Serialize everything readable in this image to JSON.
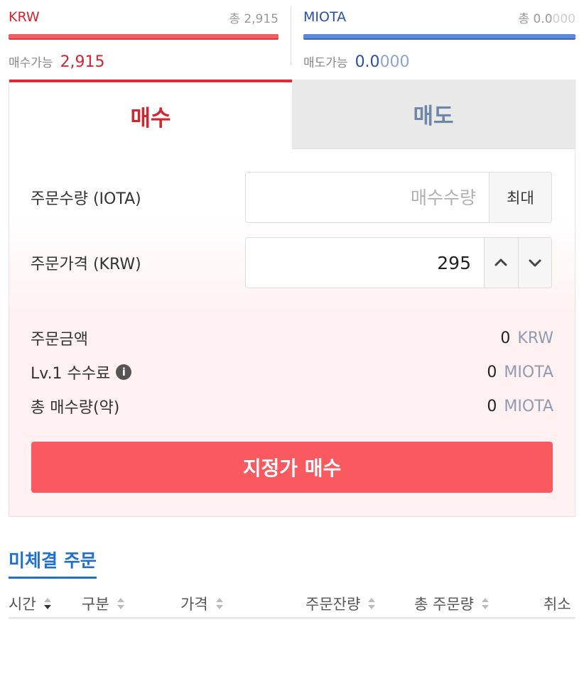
{
  "balances": {
    "krw": {
      "currency": "KRW",
      "total_label": "총",
      "total_value": "2,915",
      "total_dim": "",
      "available_label": "매수가능",
      "available_value": "2,915",
      "color": "#d4242f"
    },
    "miota": {
      "currency": "MIOTA",
      "total_label": "총",
      "total_value": "0.0",
      "total_dim": "000",
      "available_label": "매도가능",
      "available_value": "0.0",
      "available_dim": "000",
      "color": "#2a4fa8"
    }
  },
  "tabs": [
    {
      "label": "매수",
      "active": true
    },
    {
      "label": "매도",
      "active": false
    }
  ],
  "form": {
    "quantity": {
      "label": "주문수량 (IOTA)",
      "placeholder": "매수수량",
      "value": "",
      "max_label": "최대"
    },
    "price": {
      "label": "주문가격 (KRW)",
      "value": "295",
      "up_icon": "chevron-up-icon",
      "down_icon": "chevron-down-icon"
    }
  },
  "summary": {
    "amount": {
      "label": "주문금액",
      "value": "0",
      "unit": "KRW"
    },
    "fee": {
      "label": "Lv.1 수수료",
      "value": "0",
      "unit": "MIOTA",
      "icon": "info-icon"
    },
    "total_qty": {
      "label": "총 매수량(약)",
      "value": "0",
      "unit": "MIOTA"
    }
  },
  "submit_label": "지정가 매수",
  "pending": {
    "title": "미체결 주문",
    "columns": [
      "시간",
      "구분",
      "가격",
      "주문잔량",
      "총 주문량",
      "취소"
    ]
  },
  "colors": {
    "buy_red": "#fa5a5f",
    "sell_blue": "#5c8ad8",
    "link_blue": "#1f6fd0"
  }
}
